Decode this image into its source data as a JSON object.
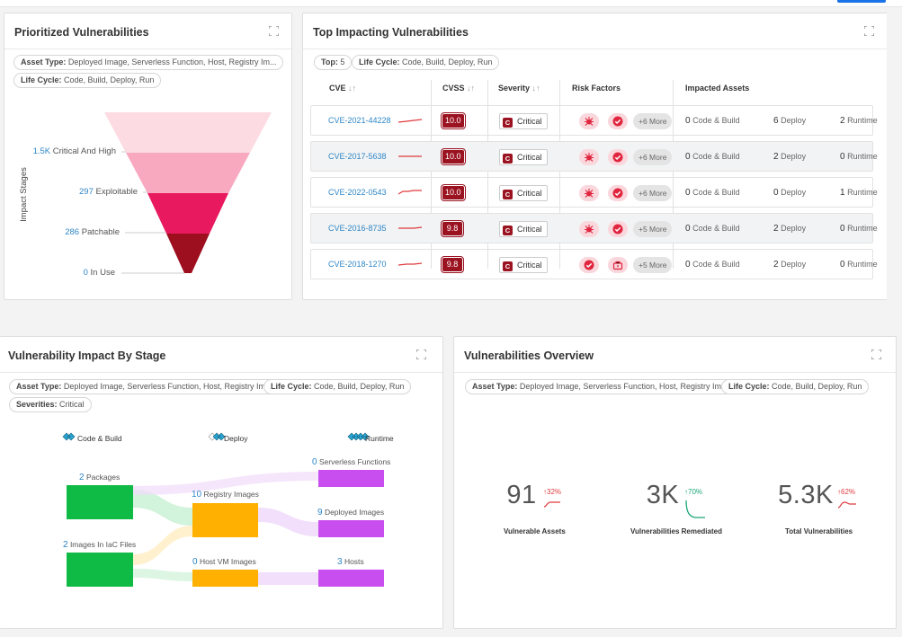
{
  "colors": {
    "link": "#2e86c7",
    "critical": "#9b1221",
    "funnel": [
      "#fcdbe2",
      "#f8a9c0",
      "#e8195e",
      "#9d0e1f"
    ],
    "code_build": "#10bb45",
    "deploy": "#ffb000",
    "runtime": "#c84ef0",
    "up_bad": "#e03a3e",
    "up_good": "#1aa776"
  },
  "prioritized": {
    "title": "Prioritized Vulnerabilities",
    "chips": [
      {
        "key": "Asset Type:",
        "value": "Deployed Image, Serverless Function, Host, Registry Im..."
      },
      {
        "key": "Life Cycle:",
        "value": "Code, Build, Deploy, Run"
      }
    ],
    "axis_title": "Impact Stages",
    "stages": [
      {
        "value": "1.5K",
        "label": "Critical And High"
      },
      {
        "value": "297",
        "label": "Exploitable"
      },
      {
        "value": "286",
        "label": "Patchable"
      },
      {
        "value": "0",
        "label": "In Use"
      }
    ]
  },
  "top": {
    "title": "Top Impacting Vulnerabilities",
    "chips": [
      {
        "key": "Top:",
        "value": "5"
      },
      {
        "key": "Life Cycle:",
        "value": "Code, Build, Deploy, Run"
      }
    ],
    "columns": [
      "CVE",
      "CVSS",
      "Severity",
      "Risk Factors",
      "Impacted Assets"
    ],
    "sort_icon": "↓↑",
    "asset_labels": [
      "Code & Build",
      "Deploy",
      "Runtime"
    ],
    "rows": [
      {
        "cve": "CVE-2021-44228",
        "cvss": "10.0",
        "severity": "Critical",
        "factors": [
          "bug-icon",
          "check-shield-icon"
        ],
        "more": "+6 More",
        "code": "0",
        "deploy": "6",
        "runtime": "2"
      },
      {
        "cve": "CVE-2017-5638",
        "cvss": "10.0",
        "severity": "Critical",
        "factors": [
          "bug-icon",
          "check-shield-icon"
        ],
        "more": "+6 More",
        "code": "0",
        "deploy": "2",
        "runtime": "0"
      },
      {
        "cve": "CVE-2022-0543",
        "cvss": "10.0",
        "severity": "Critical",
        "factors": [
          "bug-icon",
          "check-shield-icon"
        ],
        "more": "+6 More",
        "code": "0",
        "deploy": "0",
        "runtime": "1"
      },
      {
        "cve": "CVE-2016-8735",
        "cvss": "9.8",
        "severity": "Critical",
        "factors": [
          "bug-icon",
          "check-shield-icon"
        ],
        "more": "+5 More",
        "code": "0",
        "deploy": "2",
        "runtime": "0"
      },
      {
        "cve": "CVE-2018-1270",
        "cvss": "9.8",
        "severity": "Critical",
        "factors": [
          "check-shield-icon",
          "exploit-icon"
        ],
        "more": "+5 More",
        "code": "0",
        "deploy": "2",
        "runtime": "0"
      }
    ],
    "severity_letter": "C"
  },
  "impact": {
    "title": "Vulnerability Impact By Stage",
    "chips": [
      {
        "key": "Asset Type:",
        "value": "Deployed Image, Serverless Function, Host, Registry Im..."
      },
      {
        "key": "Life Cycle:",
        "value": "Code, Build, Deploy, Run"
      },
      {
        "key": "Severities:",
        "value": "Critical"
      }
    ],
    "stages": [
      "Code & Build",
      "Deploy",
      "Runtime"
    ],
    "nodes": {
      "packages": {
        "value": "2",
        "label": "Packages"
      },
      "iac": {
        "value": "2",
        "label": "Images In IaC Files"
      },
      "registry": {
        "value": "10",
        "label": "Registry Images"
      },
      "hostvm": {
        "value": "0",
        "label": "Host VM Images"
      },
      "serverless": {
        "value": "0",
        "label": "Serverless Functions"
      },
      "deployed": {
        "value": "9",
        "label": "Deployed Images"
      },
      "hosts": {
        "value": "3",
        "label": "Hosts"
      }
    }
  },
  "overview": {
    "title": "Vulnerabilities Overview",
    "chips": [
      {
        "key": "Asset Type:",
        "value": "Deployed Image, Serverless Function, Host, Registry Im..."
      },
      {
        "key": "Life Cycle:",
        "value": "Code, Build, Deploy, Run"
      }
    ],
    "kpis": [
      {
        "value": "91",
        "trend": "32%",
        "label": "Vulnerable Assets",
        "direction": "up-bad"
      },
      {
        "value": "3K",
        "trend": "70%",
        "label": "Vulnerabilities Remediated",
        "direction": "up-good"
      },
      {
        "value": "5.3K",
        "trend": "62%",
        "label": "Total Vulnerabilities",
        "direction": "up-bad"
      }
    ],
    "trend_arrow": "↑"
  }
}
